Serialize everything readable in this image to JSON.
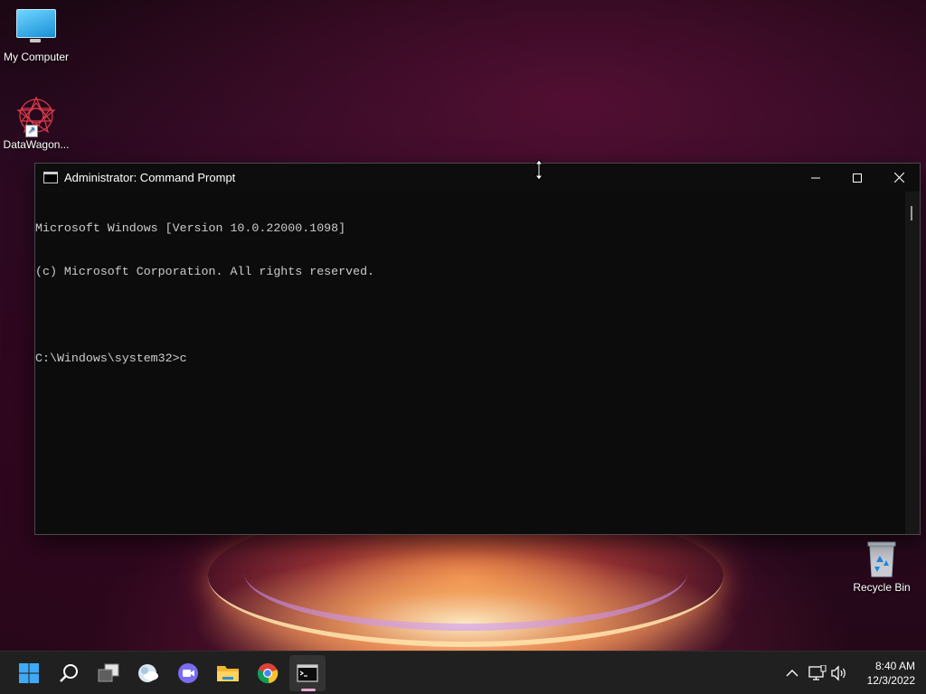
{
  "desktop": {
    "icons": [
      {
        "label": "My Computer",
        "icon": "computer-monitor-icon"
      },
      {
        "label": "DataWagon...",
        "icon": "datawagon-logo-icon"
      },
      {
        "label": "Recycle Bin",
        "icon": "recycle-bin-icon"
      }
    ]
  },
  "window": {
    "title": "Administrator: Command Prompt",
    "controls": [
      "minimize-icon",
      "maximize-icon",
      "close-icon"
    ],
    "console_lines": [
      "Microsoft Windows [Version 10.0.22000.1098]",
      "(c) Microsoft Corporation. All rights reserved.",
      "",
      "C:\\Windows\\system32>c"
    ]
  },
  "taskbar": {
    "apps": [
      "start-icon",
      "search-icon",
      "task-view-icon",
      "widgets-icon",
      "chat-icon",
      "file-explorer-icon",
      "chrome-icon",
      "command-prompt-icon"
    ],
    "active_app": "command-prompt-icon",
    "tray": [
      "chevron-up-icon",
      "network-icon",
      "volume-icon"
    ],
    "time": "8:40 AM",
    "date": "12/3/2022"
  },
  "colors": {
    "console_bg": "#0c0c0c",
    "console_text": "#cccccc",
    "taskbar_bg": "#202020",
    "accent": "#e6a8d0"
  }
}
